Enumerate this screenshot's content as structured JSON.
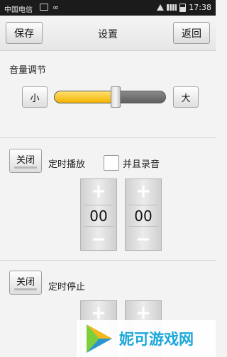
{
  "status_bar": {
    "carrier": "中国电信",
    "time": "17:38"
  },
  "header": {
    "save_label": "保存",
    "title": "设置",
    "return_label": "返回"
  },
  "volume": {
    "label": "音量调节",
    "decrease_label": "小",
    "increase_label": "大",
    "level": 0.55,
    "accent": "#f4b400"
  },
  "timed_play": {
    "toggle_label": "关闭",
    "label": "定时播放",
    "record_label": "并且录音",
    "record_checked": false,
    "hour": "00",
    "minute": "00",
    "plus": "+",
    "minus": "−"
  },
  "timed_stop": {
    "toggle_label": "关闭",
    "label": "定时停止",
    "plus": "+"
  },
  "watermark": {
    "brand": "妮可游戏网",
    "color": "#1aa7d9"
  }
}
